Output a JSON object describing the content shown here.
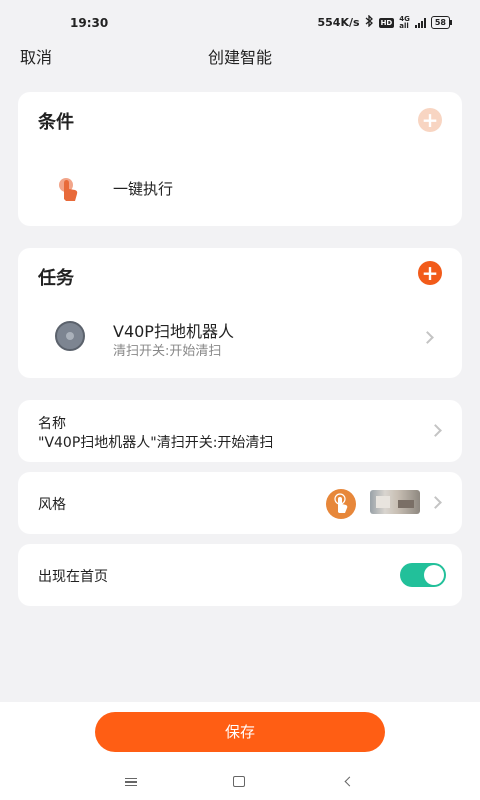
{
  "status_bar": {
    "time": "19:30",
    "net_speed": "554K/s",
    "hd": "HD",
    "net_top": "4G",
    "net_bottom": "all",
    "battery": "58"
  },
  "header": {
    "cancel_label": "取消",
    "title": "创建智能"
  },
  "condition": {
    "title": "条件",
    "item_label": "一键执行"
  },
  "task": {
    "title": "任务",
    "device_name": "V40P扫地机器人",
    "device_action": "清扫开关:开始清扫"
  },
  "name_row": {
    "label": "名称",
    "value": "\"V40P扫地机器人\"清扫开关:开始清扫"
  },
  "style_row": {
    "label": "风格"
  },
  "homepage_row": {
    "label": "出现在首页",
    "enabled": true
  },
  "save_label": "保存",
  "colors": {
    "accent": "#ff5e14",
    "toggle_on": "#22c09a",
    "plus_disabled": "#f8d5c2",
    "plus_active": "#f25b1a"
  },
  "icons": {
    "condition_add": "plus-icon",
    "task_add": "plus-icon",
    "condition_item": "hand-tap-icon",
    "device": "robot-vacuum-icon"
  }
}
